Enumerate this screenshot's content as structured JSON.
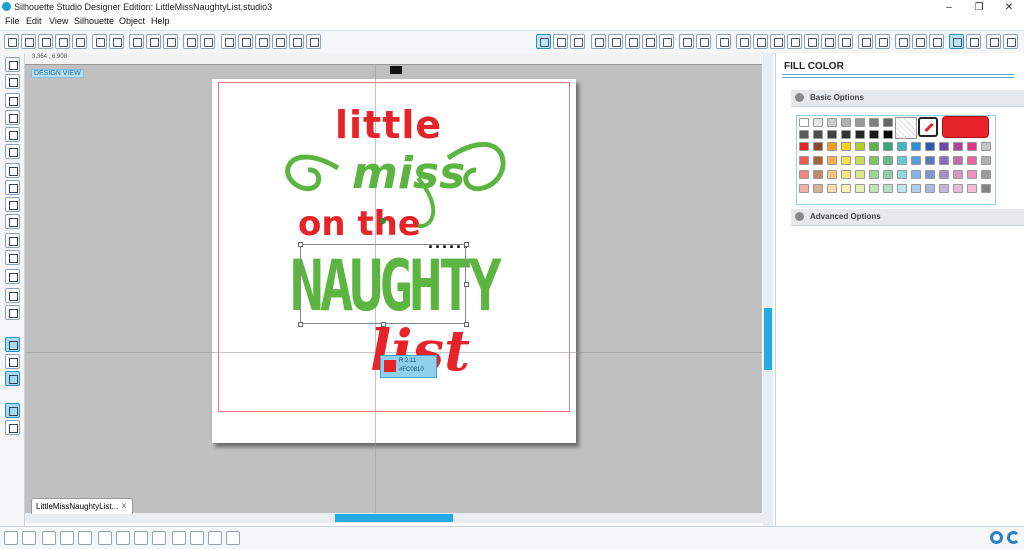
{
  "window": {
    "title": "Silhouette Studio Designer Edition: LittleMissNaughtyList.studio3",
    "controls": {
      "minimize": "–",
      "maximize": "❐",
      "close": "✕"
    }
  },
  "menu": [
    "File",
    "Edit",
    "View",
    "Silhouette",
    "Object",
    "Help"
  ],
  "workspace": {
    "design_view_label": "DESIGN VIEW",
    "ruler_coords": "3.364 , 6.908",
    "document_tab": "LittleMissNaughtyList...",
    "document_tab_close": "x"
  },
  "design": {
    "line1": "little",
    "line2": "miss",
    "line3": "on the",
    "dots": "......",
    "line4": "NAUGHTY",
    "line5": "list",
    "colors": {
      "red": "#e52329",
      "green": "#5cb541"
    }
  },
  "color_chip": {
    "line1": "R:2.11",
    "line2": "#FC0810"
  },
  "fill_panel": {
    "title": "FILL COLOR",
    "basic_options": "Basic Options",
    "advanced_options": "Advanced Options",
    "selected_color": "#e52329",
    "palette_rows": [
      [
        "#ffffff",
        "#e6e6e6",
        "#cccccc",
        "#b3b3b3",
        "#999999",
        "#808080",
        "#666666"
      ],
      [
        "#595959",
        "#4d4d4d",
        "#404040",
        "#333333",
        "#262626",
        "#1a1a1a",
        "#000000"
      ],
      [
        "#e52329",
        "#8b4a2b",
        "#f39a1d",
        "#f5d10e",
        "#b5cf2a",
        "#5cb541",
        "#3aa57a",
        "#3db9c6",
        "#2b8fd0",
        "#2b5bb0",
        "#6e4aa8",
        "#b0449a",
        "#e0368a",
        "#c5c5c5"
      ],
      [
        "#ee5a55",
        "#a5643d",
        "#f7b04e",
        "#f9df4c",
        "#c9dd5b",
        "#7dc66a",
        "#62bb94",
        "#66cad4",
        "#579fdb",
        "#5478c2",
        "#8b6bba",
        "#c26bb0",
        "#ea65a3",
        "#b0b0b0"
      ],
      [
        "#f38481",
        "#bf8a66",
        "#f9c67f",
        "#fbe77f",
        "#d8e78a",
        "#9fd593",
        "#8ccdaf",
        "#8fd9e0",
        "#83b7e4",
        "#7f98d1",
        "#a88dcb",
        "#d294c5",
        "#f092bd",
        "#9a9a9a"
      ],
      [
        "#f7adab",
        "#d6b295",
        "#fcdbae",
        "#fdefae",
        "#e6f0b6",
        "#c1e4bb",
        "#b6dfcc",
        "#b9e7ec",
        "#b0cfee",
        "#aabbe1",
        "#c7b3dc",
        "#e3bcda",
        "#f6bdd7",
        "#858585"
      ]
    ]
  }
}
